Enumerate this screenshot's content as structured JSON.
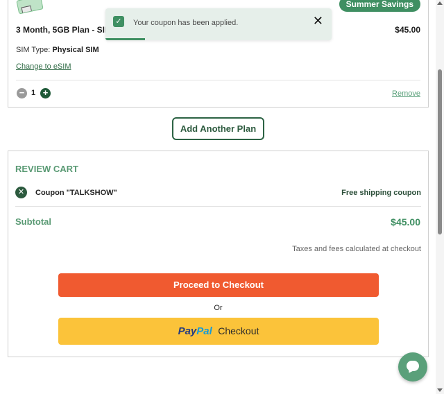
{
  "cart_item": {
    "promo_badge": "Summer Savings",
    "plan_name": "3 Month, 5GB Plan - SIM",
    "price": "$45.00",
    "sim_type_label": "SIM Type:",
    "sim_type_value": "Physical SIM",
    "change_link": "Change to eSIM",
    "quantity": "1",
    "minus_symbol": "−",
    "plus_symbol": "+",
    "remove_link": "Remove"
  },
  "toast": {
    "message": "Your coupon has been applied.",
    "check_symbol": "✓",
    "close_symbol": "✕"
  },
  "add_plan_label": "Add Another Plan",
  "review_cart": {
    "title": "REVIEW CART",
    "coupon_remove_symbol": "✕",
    "coupon_name": "Coupon \"TALKSHOW\"",
    "coupon_type": "Free shipping coupon",
    "subtotal_label": "Subtotal",
    "subtotal_value": "$45.00",
    "tax_note": "Taxes and fees calculated at checkout",
    "checkout_label": "Proceed to Checkout",
    "or_label": "Or",
    "paypal_pay": "Pay",
    "paypal_pal": "Pal",
    "paypal_checkout": "Checkout"
  },
  "colors": {
    "brand_green": "#3f8f62",
    "checkout_orange": "#f05a30",
    "paypal_yellow": "#fbc33a"
  },
  "icons": {
    "sim": "sim-card-icon",
    "toast_check": "check-icon",
    "toast_close": "close-icon",
    "coupon_remove": "close-circle-icon",
    "chat": "chat-bubble-icon"
  }
}
